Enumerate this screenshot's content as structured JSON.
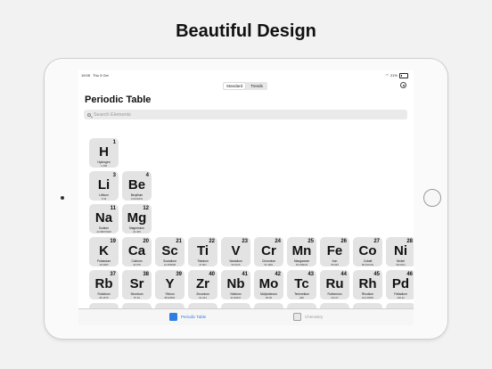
{
  "headline": "Beautiful Design",
  "status": {
    "time": "19:05",
    "date": "Thu 3 Oct",
    "battery": "21%"
  },
  "segments": [
    {
      "label": "Standard",
      "active": true
    },
    {
      "label": "Trends",
      "active": false
    }
  ],
  "page_title": "Periodic Table",
  "search": {
    "placeholder": "Search Elements"
  },
  "elements": [
    {
      "number": "1",
      "symbol": "H",
      "name": "Hydrogen",
      "mass": "1.008"
    },
    {
      "number": "3",
      "symbol": "Li",
      "name": "Lithium",
      "mass": "6.94"
    },
    {
      "number": "4",
      "symbol": "Be",
      "name": "Beryllium",
      "mass": "9.0121831"
    },
    {
      "number": "11",
      "symbol": "Na",
      "name": "Sodium",
      "mass": "22.98976928"
    },
    {
      "number": "12",
      "symbol": "Mg",
      "name": "Magnesium",
      "mass": "24.305"
    },
    {
      "number": "19",
      "symbol": "K",
      "name": "Potassium",
      "mass": "39.0983"
    },
    {
      "number": "20",
      "symbol": "Ca",
      "name": "Calcium",
      "mass": "40.078"
    },
    {
      "number": "21",
      "symbol": "Sc",
      "name": "Scandium",
      "mass": "44.955908"
    },
    {
      "number": "22",
      "symbol": "Ti",
      "name": "Titanium",
      "mass": "47.867"
    },
    {
      "number": "23",
      "symbol": "V",
      "name": "Vanadium",
      "mass": "50.9415"
    },
    {
      "number": "24",
      "symbol": "Cr",
      "name": "Chromium",
      "mass": "51.9961"
    },
    {
      "number": "25",
      "symbol": "Mn",
      "name": "Manganese",
      "mass": "54.938044"
    },
    {
      "number": "26",
      "symbol": "Fe",
      "name": "Iron",
      "mass": "55.845"
    },
    {
      "number": "27",
      "symbol": "Co",
      "name": "Cobalt",
      "mass": "58.933194"
    },
    {
      "number": "28",
      "symbol": "Ni",
      "name": "Nickel",
      "mass": "58.6934"
    },
    {
      "number": "37",
      "symbol": "Rb",
      "name": "Rubidium",
      "mass": "85.4678"
    },
    {
      "number": "38",
      "symbol": "Sr",
      "name": "Strontium",
      "mass": "87.62"
    },
    {
      "number": "39",
      "symbol": "Y",
      "name": "Yttrium",
      "mass": "88.90584"
    },
    {
      "number": "40",
      "symbol": "Zr",
      "name": "Zirconium",
      "mass": "91.224"
    },
    {
      "number": "41",
      "symbol": "Nb",
      "name": "Niobium",
      "mass": "92.90637"
    },
    {
      "number": "42",
      "symbol": "Mo",
      "name": "Molybdenum",
      "mass": "95.95"
    },
    {
      "number": "43",
      "symbol": "Tc",
      "name": "Technetium",
      "mass": "(98)"
    },
    {
      "number": "44",
      "symbol": "Ru",
      "name": "Ruthenium",
      "mass": "101.07"
    },
    {
      "number": "45",
      "symbol": "Rh",
      "name": "Rhodium",
      "mass": "102.90550"
    },
    {
      "number": "46",
      "symbol": "Pd",
      "name": "Palladium",
      "mass": "106.42"
    }
  ],
  "tabs": [
    {
      "label": "Periodic Table",
      "icon": "table-icon",
      "active": true
    },
    {
      "label": "Chemistry",
      "icon": "beaker-icon",
      "active": false
    }
  ],
  "colors": {
    "tile": "#e3e3e3",
    "accent": "#2f7de1"
  }
}
